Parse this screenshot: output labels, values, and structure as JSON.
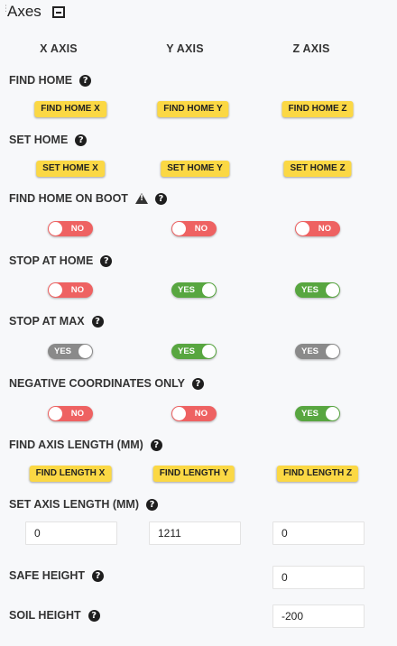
{
  "panel": {
    "title": "Axes"
  },
  "columns": [
    "X AXIS",
    "Y AXIS",
    "Z AXIS"
  ],
  "find_home": {
    "label": "FIND HOME",
    "buttons": [
      "FIND HOME X",
      "FIND HOME Y",
      "FIND HOME Z"
    ]
  },
  "set_home": {
    "label": "SET HOME",
    "buttons": [
      "SET HOME X",
      "SET HOME Y",
      "SET HOME Z"
    ]
  },
  "find_home_on_boot": {
    "label": "FIND HOME ON BOOT",
    "toggles": [
      "NO",
      "NO",
      "NO"
    ]
  },
  "stop_at_home": {
    "label": "STOP AT HOME",
    "toggles": [
      "NO",
      "YES",
      "YES"
    ]
  },
  "stop_at_max": {
    "label": "STOP AT MAX",
    "toggles": [
      "YES",
      "YES",
      "YES"
    ]
  },
  "negative_coordinates_only": {
    "label": "NEGATIVE COORDINATES ONLY",
    "toggles": [
      "NO",
      "NO",
      "YES"
    ]
  },
  "find_axis_length": {
    "label": "FIND AXIS LENGTH (MM)",
    "buttons": [
      "FIND LENGTH X",
      "FIND LENGTH Y",
      "FIND LENGTH Z"
    ]
  },
  "set_axis_length": {
    "label": "SET AXIS LENGTH (MM)",
    "values": [
      "0",
      "1211",
      "0"
    ]
  },
  "safe_height": {
    "label": "SAFE HEIGHT",
    "value": "0"
  },
  "soil_height": {
    "label": "SOIL HEIGHT",
    "value": "-200"
  },
  "colors": {
    "button_yellow": "#fbd844",
    "toggle_no": "#ee6262",
    "toggle_yes": "#58a640",
    "toggle_yes_inactive": "#8a8a8a"
  }
}
